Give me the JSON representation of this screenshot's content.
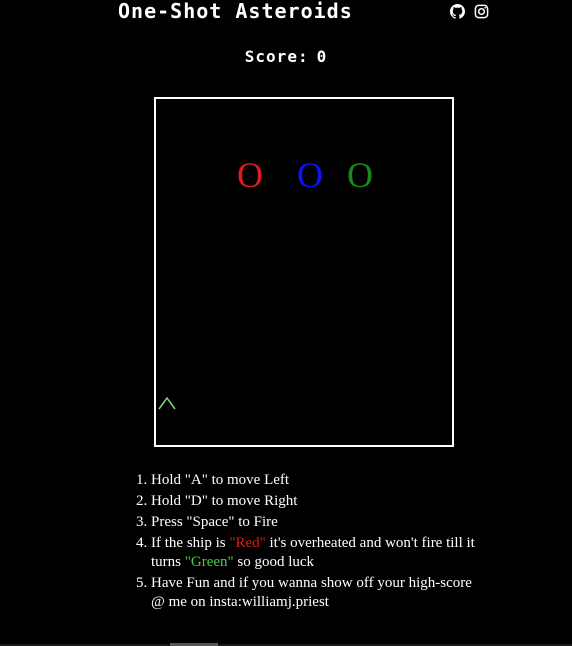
{
  "header": {
    "title": "One-Shot Asteroids",
    "icons": [
      "github-icon",
      "instagram-icon"
    ]
  },
  "score": {
    "label": "Score:",
    "value": "0"
  },
  "game": {
    "asteroids": [
      {
        "glyph": "O",
        "color": "#e01b1b"
      },
      {
        "glyph": "O",
        "color": "#1010ff"
      },
      {
        "glyph": "O",
        "color": "#1a8a1a"
      }
    ],
    "ship": {
      "color": "#7dd87d"
    }
  },
  "instructions": {
    "item1": "Hold \"A\" to move Left",
    "item2": "Hold \"D\" to move Right",
    "item3": "Press \"Space\" to Fire",
    "item4_a": "If the ship is ",
    "item4_red": "\"Red\"",
    "item4_b": " it's overheated and won't fire till it turns ",
    "item4_green": "\"Green\"",
    "item4_c": " so good luck",
    "item5": "Have Fun and if you wanna show off your high-score @ me on insta:williamj.priest"
  },
  "colors": {
    "red": "#e01b1b",
    "green": "#4ec94e"
  }
}
